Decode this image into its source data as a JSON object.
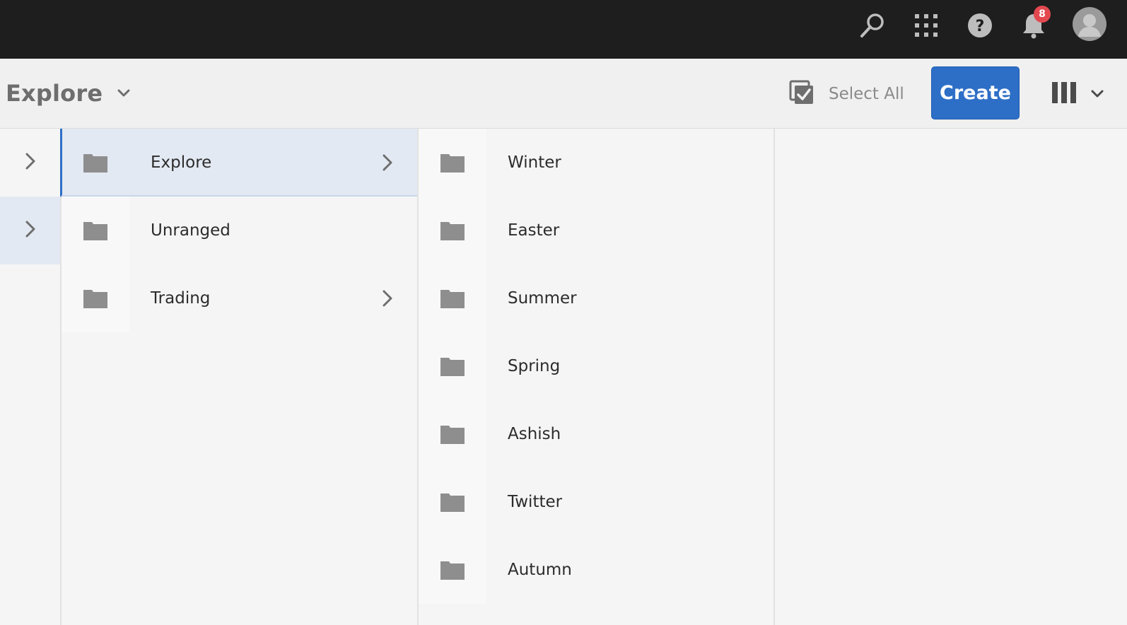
{
  "shell": {
    "icons": [
      "search-icon",
      "apps-grid-icon",
      "help-icon",
      "notifications-icon",
      "avatar"
    ],
    "notification_count": "8"
  },
  "actionbar": {
    "title": "Explore",
    "select_all_label": "Select All",
    "create_label": "Create",
    "view_mode": "column-view"
  },
  "columns": {
    "nav": [
      {
        "icon": "chevron-right-icon",
        "active": false
      },
      {
        "icon": "chevron-right-icon",
        "active": true
      }
    ],
    "level1": [
      {
        "label": "Explore",
        "has_children": true,
        "selected": true
      },
      {
        "label": "Unranged",
        "has_children": false,
        "selected": false
      },
      {
        "label": "Trading",
        "has_children": true,
        "selected": false
      }
    ],
    "level2": [
      {
        "label": "Winter"
      },
      {
        "label": "Easter"
      },
      {
        "label": "Summer"
      },
      {
        "label": "Spring"
      },
      {
        "label": "Ashish"
      },
      {
        "label": "Twitter"
      },
      {
        "label": "Autumn"
      }
    ]
  },
  "colors": {
    "accent": "#2d6fc7",
    "shell_bg": "#1e1e1e",
    "badge": "#e34850",
    "selected_row": "#e3e9f2"
  }
}
